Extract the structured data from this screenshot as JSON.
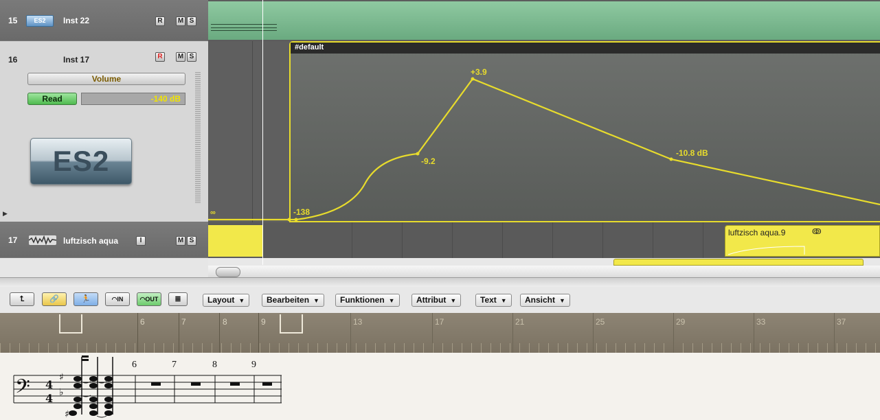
{
  "tracks": [
    {
      "number": "15",
      "icon_text": "ES2",
      "name": "Inst 22",
      "buttons": [
        "R",
        "M",
        "S"
      ]
    },
    {
      "number": "16",
      "name": "Inst 17",
      "buttons": [
        "R",
        "M",
        "S"
      ],
      "param": "Volume",
      "mode": "Read",
      "value": "-140 dB",
      "plugin_logo": "ES2"
    },
    {
      "number": "17",
      "name": "luftzisch aqua",
      "buttons": [
        "I",
        "M",
        "S"
      ]
    }
  ],
  "arrange": {
    "region_name": "#default",
    "automation_labels": [
      "-138",
      "-9.2",
      "+3.9",
      "-10.8 dB"
    ],
    "left_label": "∞",
    "audio_region": "luftzisch aqua.9"
  },
  "automation": {
    "unit": "dB",
    "points": [
      -138,
      -9.2,
      3.9,
      -10.8
    ]
  },
  "toolbar": {
    "icons": [
      "up-arrow-icon",
      "link-icon",
      "catch-icon",
      "midi-in-icon",
      "midi-out-icon",
      "list-icon"
    ],
    "menus": [
      "Layout",
      "Bearbeiten",
      "Funktionen",
      "Attribut",
      "Text",
      "Ansicht"
    ]
  },
  "score_ruler": {
    "bars": [
      "6",
      "7",
      "8",
      "9",
      "13",
      "17",
      "21",
      "25",
      "29",
      "33",
      "37"
    ]
  },
  "score": {
    "measure_numbers": [
      "6",
      "7",
      "8",
      "9"
    ]
  }
}
